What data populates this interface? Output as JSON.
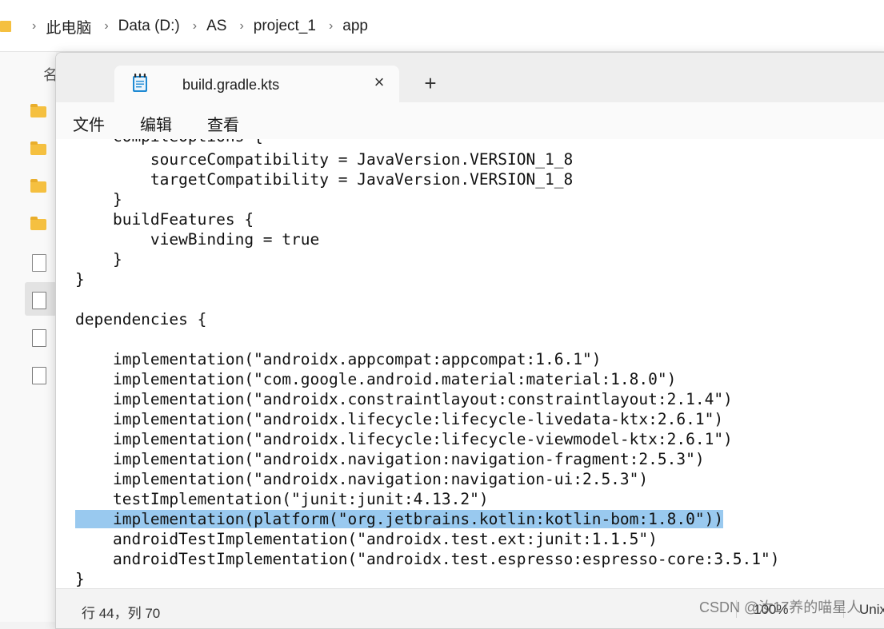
{
  "explorer": {
    "breadcrumbs": [
      "此电脑",
      "Data (D:)",
      "AS",
      "project_1",
      "app"
    ],
    "column_header": "名"
  },
  "notepad": {
    "tab_title": "build.gradle.kts",
    "menu": [
      "文件",
      "编辑",
      "查看"
    ],
    "code_lines": [
      "    compileOptions {",
      "        sourceCompatibility = JavaVersion.VERSION_1_8",
      "        targetCompatibility = JavaVersion.VERSION_1_8",
      "    }",
      "    buildFeatures {",
      "        viewBinding = true",
      "    }",
      "}",
      "",
      "dependencies {",
      "",
      "    implementation(\"androidx.appcompat:appcompat:1.6.1\")",
      "    implementation(\"com.google.android.material:material:1.8.0\")",
      "    implementation(\"androidx.constraintlayout:constraintlayout:2.1.4\")",
      "    implementation(\"androidx.lifecycle:lifecycle-livedata-ktx:2.6.1\")",
      "    implementation(\"androidx.lifecycle:lifecycle-viewmodel-ktx:2.6.1\")",
      "    implementation(\"androidx.navigation:navigation-fragment:2.5.3\")",
      "    implementation(\"androidx.navigation:navigation-ui:2.5.3\")",
      "    testImplementation(\"junit:junit:4.13.2\")",
      "    implementation(platform(\"org.jetbrains.kotlin:kotlin-bom:1.8.0\"))",
      "    androidTestImplementation(\"androidx.test.ext:junit:1.1.5\")",
      "    androidTestImplementation(\"androidx.test.espresso:espresso-core:3.5.1\")",
      "}"
    ],
    "highlighted_line": "implementation(platform(\"org.jetbrains.kotlin:kotlin-bom:1.8.0\"))",
    "status": {
      "position": "行 44，列 70",
      "zoom": "100%",
      "line_ending": "Unix"
    }
  },
  "watermark": "CSDN @汝17养的喵星人"
}
